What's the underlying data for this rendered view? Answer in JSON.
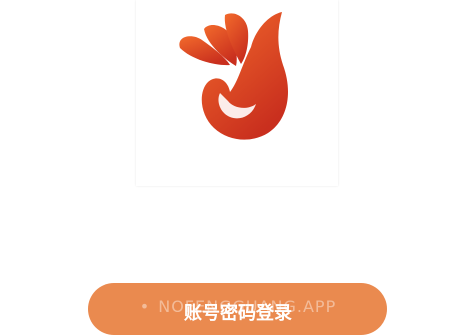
{
  "logo": {
    "icon": "flame-bird-icon",
    "gradient_start": "#f26a2c",
    "gradient_end": "#c92f1e"
  },
  "caption": {
    "dot": "•",
    "text": "NOFENGGUANG.APP"
  },
  "login_button": {
    "label": "账号密码登录",
    "color": "#ea8a4f"
  }
}
